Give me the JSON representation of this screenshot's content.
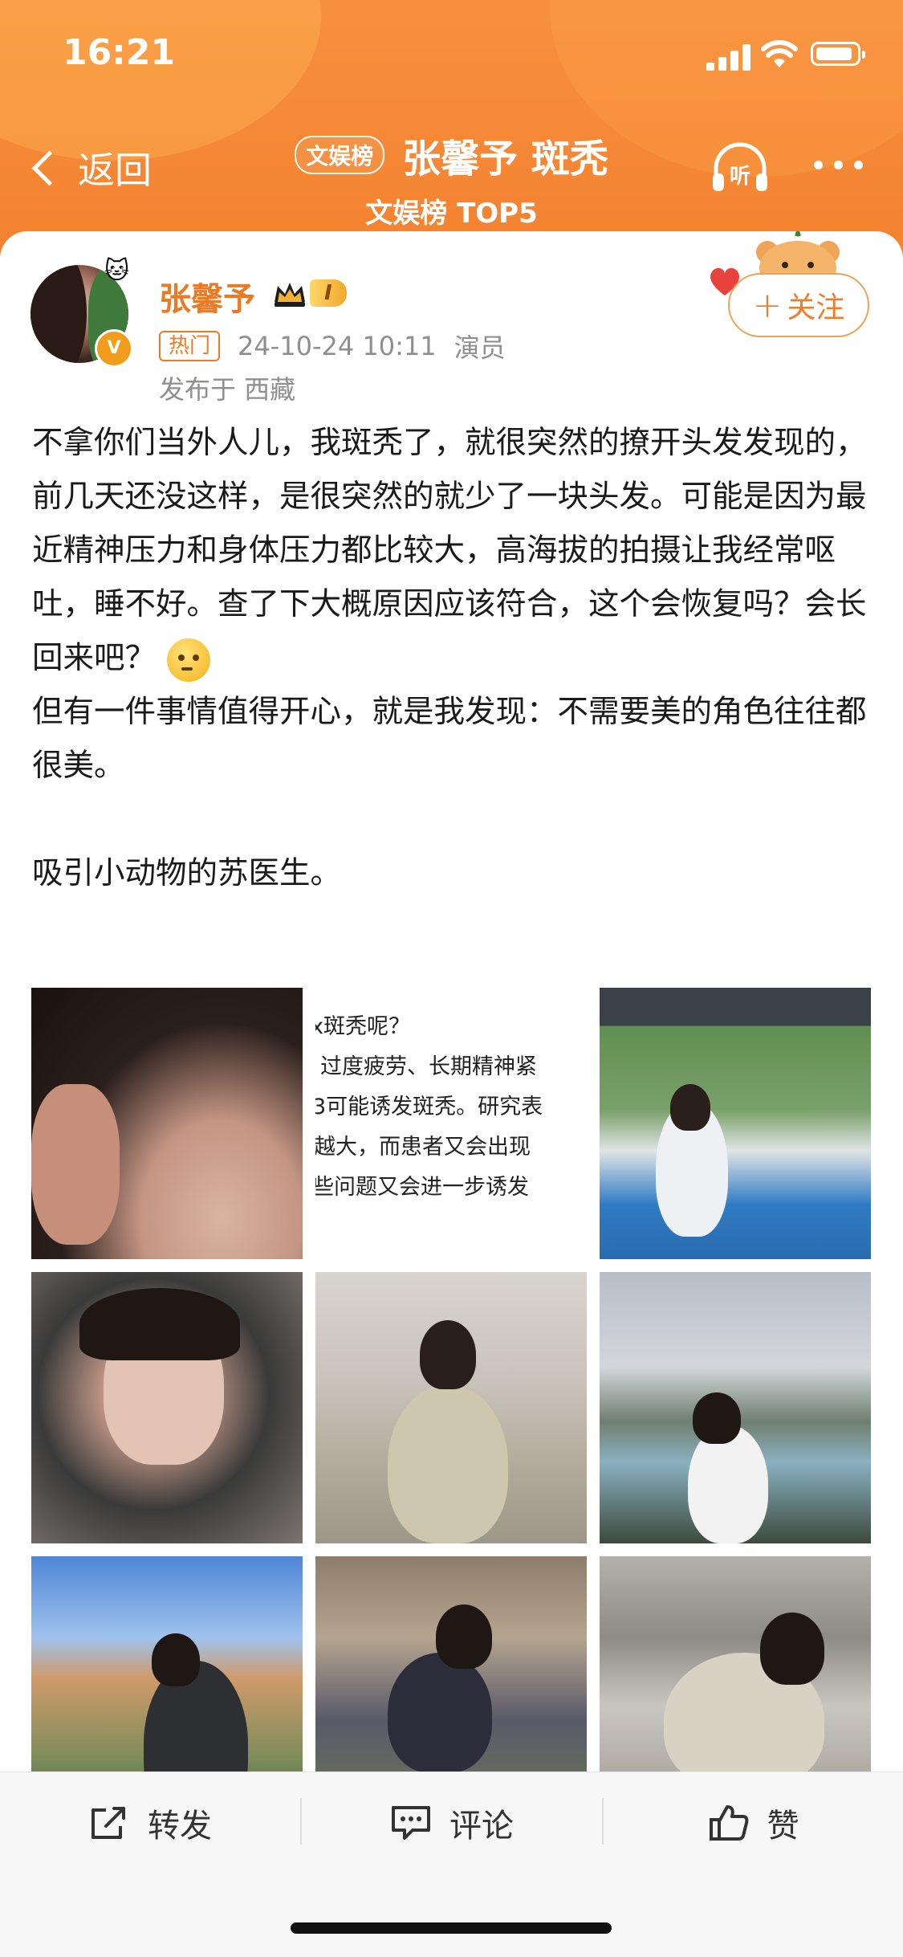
{
  "status_bar": {
    "time": "16:21"
  },
  "header": {
    "back_label": "返回",
    "tag": "文娱榜",
    "title": "张馨予 斑秃",
    "subtitle": "文娱榜 TOP5",
    "listen_label": "听"
  },
  "post": {
    "author": "张馨予",
    "level": "I",
    "hot_tag": "热门",
    "time": "24-10-24 10:11",
    "role": "演员",
    "location": "发布于 西藏",
    "follow_label": "关注",
    "paragraphs": [
      "不拿你们当外人儿，我斑秃了，就很突然的撩开头发发现的，前几天还没这样，是很突然的就少了一块头发。可能是因为最近精神压力和身体压力都比较大，高海拔的拍摄让我经常呕吐，睡不好。查了下大概原因应该符合，这个会恢复吗？会长回来吧？",
      "但有一件事情值得开心，就是我发现：不需要美的角色往往都很美。",
      "",
      "吸引小动物的苏医生。"
    ],
    "image_text_lines": [
      "x斑秃呢？",
      "过度疲劳、长期精神紧",
      "3可能诱发斑秃。研究表",
      "越大，而患者又会出现",
      "些问题又会进一步诱发"
    ],
    "images": [
      "photo-1",
      "photo-2",
      "photo-3",
      "photo-4",
      "photo-5",
      "photo-6",
      "photo-7",
      "photo-8",
      "photo-9"
    ]
  },
  "actions": {
    "repost": "转发",
    "comment": "评论",
    "like": "赞"
  },
  "colors": {
    "header_orange": "#f4822f",
    "author_orange": "#ea7a26"
  },
  "icons": [
    "chevron-left-icon",
    "headphones-icon",
    "more-icon",
    "verified-icon",
    "crown-icon",
    "repost-icon",
    "comment-icon",
    "like-icon"
  ]
}
